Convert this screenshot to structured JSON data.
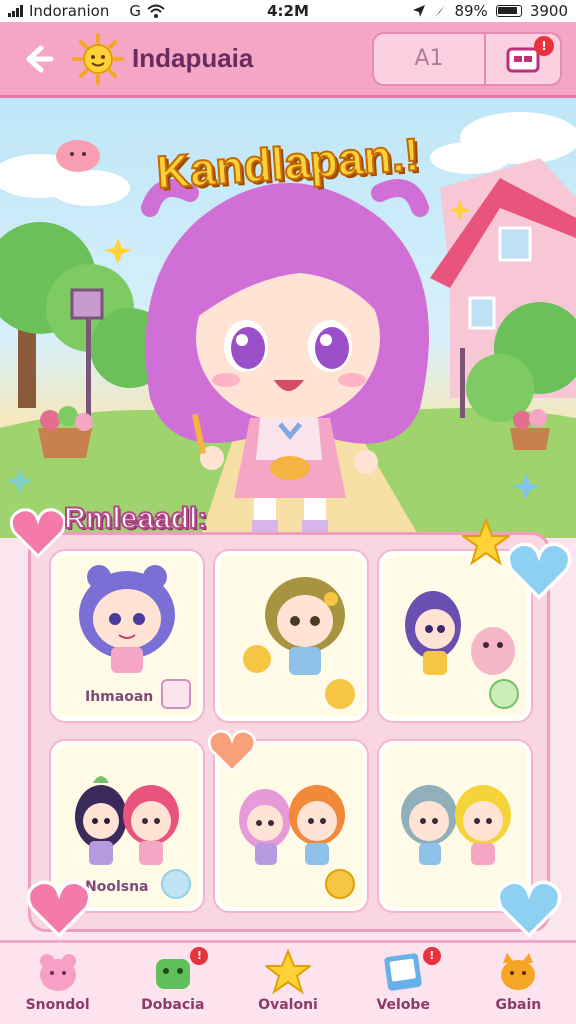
{
  "status_bar": {
    "carrier": "Indoranion",
    "network_icon": "G",
    "time": "4:2M",
    "battery_percent": "89%",
    "battery_extra": "3900"
  },
  "header": {
    "title": "Indapuaia",
    "right_text": "A1",
    "notification_badge": "!"
  },
  "scene": {
    "hero_title": "Kandlapan.!"
  },
  "collection": {
    "title": "Rmleaadl:",
    "cards": [
      {
        "label": "Ihmaoan",
        "icon": "gift-icon",
        "accent": "#d08fc0"
      },
      {
        "label": "",
        "icon": "chick-icon",
        "accent": "#f6c544"
      },
      {
        "label": "",
        "icon": "leaf-icon",
        "accent": "#76c06b"
      },
      {
        "label": "",
        "icon": "bottle-icon",
        "accent": "#8fd0e8"
      },
      {
        "label": "",
        "icon": "coin-icon",
        "accent": "#f6c544"
      },
      {
        "label": "Noolsna",
        "icon": "bottle-icon",
        "accent": "#8fd0e8"
      }
    ]
  },
  "nav": {
    "items": [
      {
        "label": "Snondol",
        "icon": "bear-icon",
        "badge": ""
      },
      {
        "label": "Dobacia",
        "icon": "frog-icon",
        "badge": "!"
      },
      {
        "label": "Ovaloni",
        "icon": "star-icon",
        "badge": ""
      },
      {
        "label": "Velobe",
        "icon": "album-icon",
        "badge": "!"
      },
      {
        "label": "Gbain",
        "icon": "cat-icon",
        "badge": ""
      }
    ]
  },
  "colors": {
    "header_pink": "#f5a6c4",
    "panel_pink": "#fad6e3",
    "title_yellow": "#ffd23a",
    "badge_red": "#e8323c"
  }
}
